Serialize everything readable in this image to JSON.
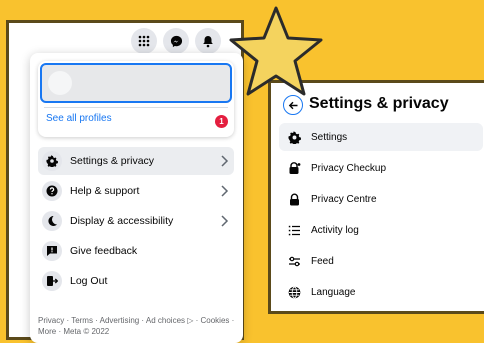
{
  "colors": {
    "background": "#f9c22e",
    "panel_border": "#5b4a1a",
    "accent": "#1877f2",
    "badge": "#e41e3f",
    "star_fill": "#f4d35e"
  },
  "topbar": {
    "icons": [
      "grid-menu-icon",
      "messenger-icon",
      "notifications-bell-icon"
    ]
  },
  "account_menu": {
    "profile": {
      "see_all_label": "See all profiles",
      "badge_count": "1"
    },
    "items": [
      {
        "label": "Settings & privacy",
        "icon": "gear-icon",
        "has_chevron": true
      },
      {
        "label": "Help & support",
        "icon": "question-icon",
        "has_chevron": true
      },
      {
        "label": "Display & accessibility",
        "icon": "moon-icon",
        "has_chevron": true
      },
      {
        "label": "Give feedback",
        "icon": "feedback-icon",
        "has_chevron": false
      },
      {
        "label": "Log Out",
        "icon": "logout-icon",
        "has_chevron": false
      }
    ],
    "footer": "Privacy · Terms · Advertising · Ad choices ▷ · Cookies · More · Meta © 2022"
  },
  "settings_panel": {
    "title": "Settings & privacy",
    "items": [
      {
        "label": "Settings",
        "icon": "gear-icon"
      },
      {
        "label": "Privacy Checkup",
        "icon": "privacy-lock-icon"
      },
      {
        "label": "Privacy Centre",
        "icon": "lock-icon"
      },
      {
        "label": "Activity log",
        "icon": "list-icon"
      },
      {
        "label": "Feed",
        "icon": "sliders-icon"
      },
      {
        "label": "Language",
        "icon": "globe-icon"
      }
    ]
  }
}
